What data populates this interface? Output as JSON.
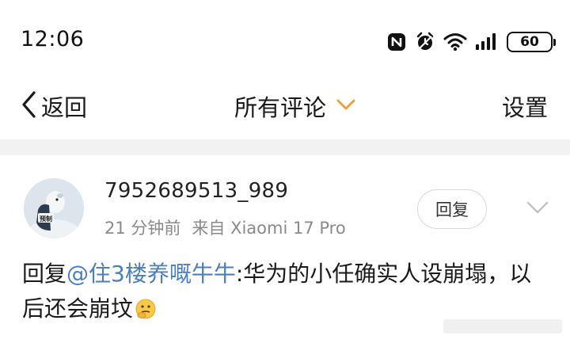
{
  "status_bar": {
    "time": "12:06",
    "battery": "60",
    "icons": [
      "nfc-icon",
      "alarm-icon",
      "wifi-icon",
      "signal-icon",
      "battery-icon"
    ]
  },
  "nav": {
    "back_label": "返回",
    "title": "所有评论",
    "settings_label": "设置"
  },
  "comment": {
    "username": "7952689513_989",
    "time_ago": "21 分钟前",
    "source": "来自 Xiaomi 17 Pro",
    "reply_button": "回复",
    "text_prefix": "回复",
    "mention": "@住3楼养嘅牛牛",
    "text_body": ":华为的小任确实人设崩塌，以后还会崩坟",
    "avatar_badge": "预制"
  },
  "colors": {
    "accent_orange": "#f0a030",
    "mention_blue": "#4a7fbf",
    "meta_gray": "#8a8a8a",
    "divider": "#f2f2f2"
  }
}
